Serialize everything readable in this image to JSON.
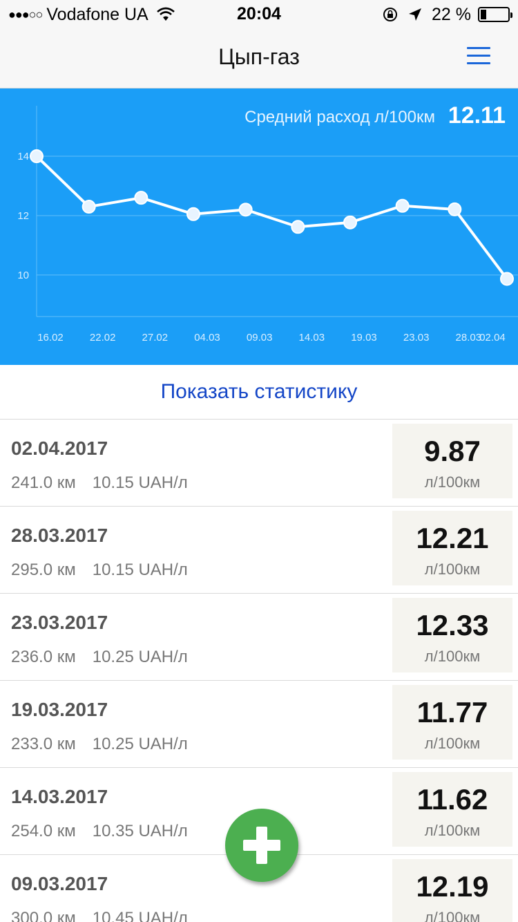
{
  "status_bar": {
    "signal_dots": "●●●○○",
    "carrier": "Vodafone UA",
    "time": "20:04",
    "battery_text": "22 %",
    "battery_level": 0.22,
    "icons": [
      "signal-dots-icon",
      "wifi-icon",
      "rotation-lock-icon",
      "location-arrow-icon",
      "battery-icon"
    ]
  },
  "nav": {
    "title": "Цып-газ",
    "menu_icon": "hamburger-menu-icon"
  },
  "chart_panel": {
    "avg_label": "Средний расход л/100км",
    "avg_value": "12.11"
  },
  "chart_data": {
    "type": "line",
    "categories": [
      "16.02",
      "22.02",
      "27.02",
      "04.03",
      "09.03",
      "14.03",
      "19.03",
      "23.03",
      "28.03",
      "02.04"
    ],
    "series": [
      {
        "values": [
          14.0,
          12.3,
          12.6,
          12.05,
          12.2,
          11.62,
          11.77,
          12.33,
          12.21,
          9.87
        ]
      }
    ],
    "y_ticks": [
      10,
      12,
      14
    ],
    "ylim": [
      8.6,
      15.7
    ],
    "grid": true,
    "colors": {
      "background": "#1b9ef7",
      "line": "#ffffff",
      "grid": "#62bffa"
    }
  },
  "stats_link": "Показать статистику",
  "entries": [
    {
      "date": "02.04.2017",
      "distance": "241.0 км",
      "price": "10.15 UAH/л",
      "consumption": "9.87",
      "unit": "л/100км"
    },
    {
      "date": "28.03.2017",
      "distance": "295.0 км",
      "price": "10.15 UAH/л",
      "consumption": "12.21",
      "unit": "л/100км"
    },
    {
      "date": "23.03.2017",
      "distance": "236.0 км",
      "price": "10.25 UAH/л",
      "consumption": "12.33",
      "unit": "л/100км"
    },
    {
      "date": "19.03.2017",
      "distance": "233.0 км",
      "price": "10.25 UAH/л",
      "consumption": "11.77",
      "unit": "л/100км"
    },
    {
      "date": "14.03.2017",
      "distance": "254.0 км",
      "price": "10.35 UAH/л",
      "consumption": "11.62",
      "unit": "л/100км"
    },
    {
      "date": "09.03.2017",
      "distance": "300.0 км",
      "price": "10.45 UAH/л",
      "consumption": "12.19",
      "unit": "л/100км"
    }
  ],
  "fab": {
    "icon": "plus-icon",
    "color": "#4caf50"
  }
}
